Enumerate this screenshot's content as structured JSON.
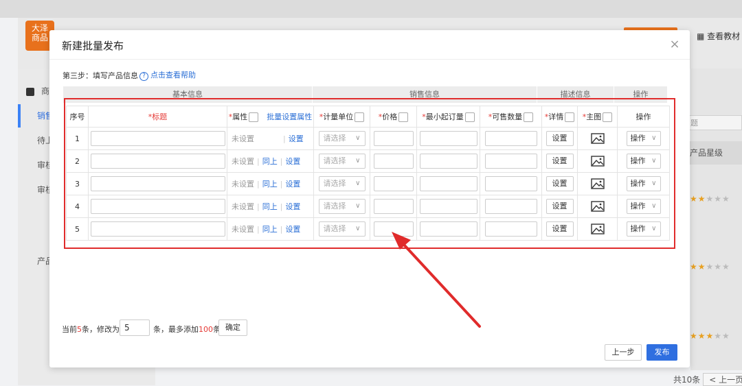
{
  "background": {
    "logo_line1": "大泽",
    "logo_line2": "商品",
    "doc_link": "查看教材",
    "sidebar_items": [
      "商",
      "销售",
      "待上",
      "审核",
      "审核",
      "产品"
    ],
    "search_placeholder": "题",
    "column_header": "产品星级",
    "stars": [
      2,
      2,
      3
    ],
    "pager_total": "共10条",
    "pager_prev": "< 上一页"
  },
  "modal": {
    "title": "新建批量发布",
    "close_glyph": "×",
    "step_text": "第三步：填写产品信息",
    "help_link": "点击查看帮助",
    "groups": [
      "基本信息",
      "销售信息",
      "描述信息",
      "操作"
    ],
    "columns": {
      "index": "序号",
      "title": "标题",
      "attr": "属性",
      "batch_attr": "批量设置属性",
      "unit": "计量单位",
      "price": "价格",
      "moq": "最小起订量",
      "stock": "可售数量",
      "detail": "详情",
      "main_image": "主图",
      "action": "操作"
    },
    "row_labels": {
      "not_set": "未设置",
      "same_as_above": "同上",
      "set": "设置",
      "select_placeholder": "请选择",
      "detail_button": "设置",
      "action_button": "操作"
    },
    "rows": [
      {
        "index": "1",
        "show_same": false
      },
      {
        "index": "2",
        "show_same": true
      },
      {
        "index": "3",
        "show_same": true
      },
      {
        "index": "4",
        "show_same": true
      },
      {
        "index": "5",
        "show_same": true
      }
    ],
    "footer": {
      "current_prefix": "当前",
      "current_count": "5",
      "current_suffix": "条，修改为",
      "input_value": "5",
      "mid_prefix": "条，最多添加",
      "max_count": "100",
      "mid_suffix": "条",
      "confirm": "确定",
      "prev_step": "上一步",
      "publish": "发布"
    }
  },
  "colors": {
    "accent": "#2f6fe0",
    "annotation": "#e02b2b",
    "required": "#e53935",
    "brand_orange": "#e8711c"
  }
}
